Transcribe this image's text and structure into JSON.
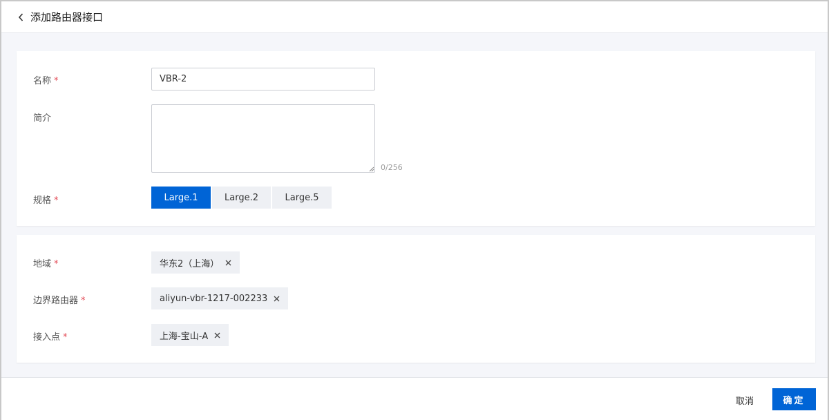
{
  "header": {
    "title": "添加路由器接口"
  },
  "form": {
    "name": {
      "label": "名称",
      "value": "VBR-2"
    },
    "description": {
      "label": "简介",
      "value": "",
      "counter": "0/256"
    },
    "spec": {
      "label": "规格",
      "options": [
        "Large.1",
        "Large.2",
        "Large.5"
      ],
      "selected": "Large.1"
    },
    "required_mark": "*"
  },
  "location": {
    "region": {
      "label": "地域",
      "tag": "华东2（上海）"
    },
    "border_router": {
      "label": "边界路由器",
      "tag": "aliyun-vbr-1217-002233"
    },
    "access_point": {
      "label": "接入点",
      "tag": "上海-宝山-A"
    }
  },
  "footer": {
    "cancel_label": "取消",
    "confirm_label": "确定"
  },
  "colors": {
    "primary": "#0064d6",
    "required": "#e34d59",
    "tag_bg": "#eef0f4",
    "page_bg": "#f5f6fa"
  }
}
